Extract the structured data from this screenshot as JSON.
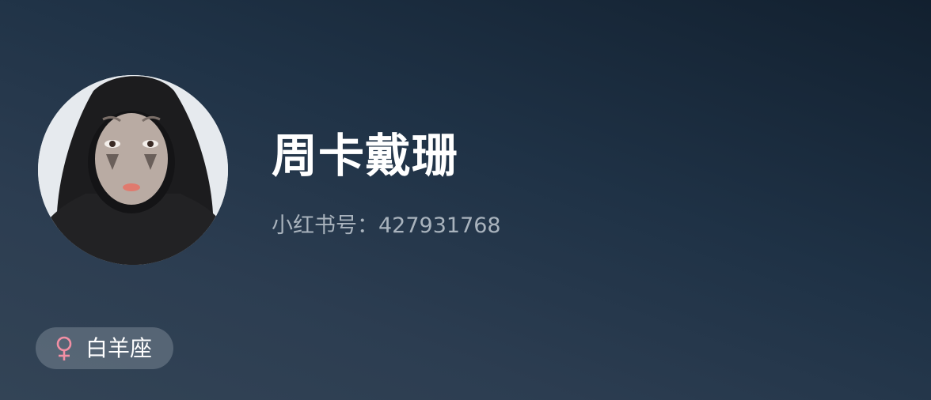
{
  "profile": {
    "username": "周卡戴珊",
    "user_id": "小红书号：427931768",
    "avatar_icon": "user-avatar-photo"
  },
  "tags": {
    "gender_icon": "female-icon",
    "gender_color": "#f28fa4",
    "zodiac": "白羊座"
  },
  "colors": {
    "background_top": "#12202f",
    "background_bottom": "#334456",
    "username": "#ffffff",
    "user_id": "#a9b3bd"
  }
}
